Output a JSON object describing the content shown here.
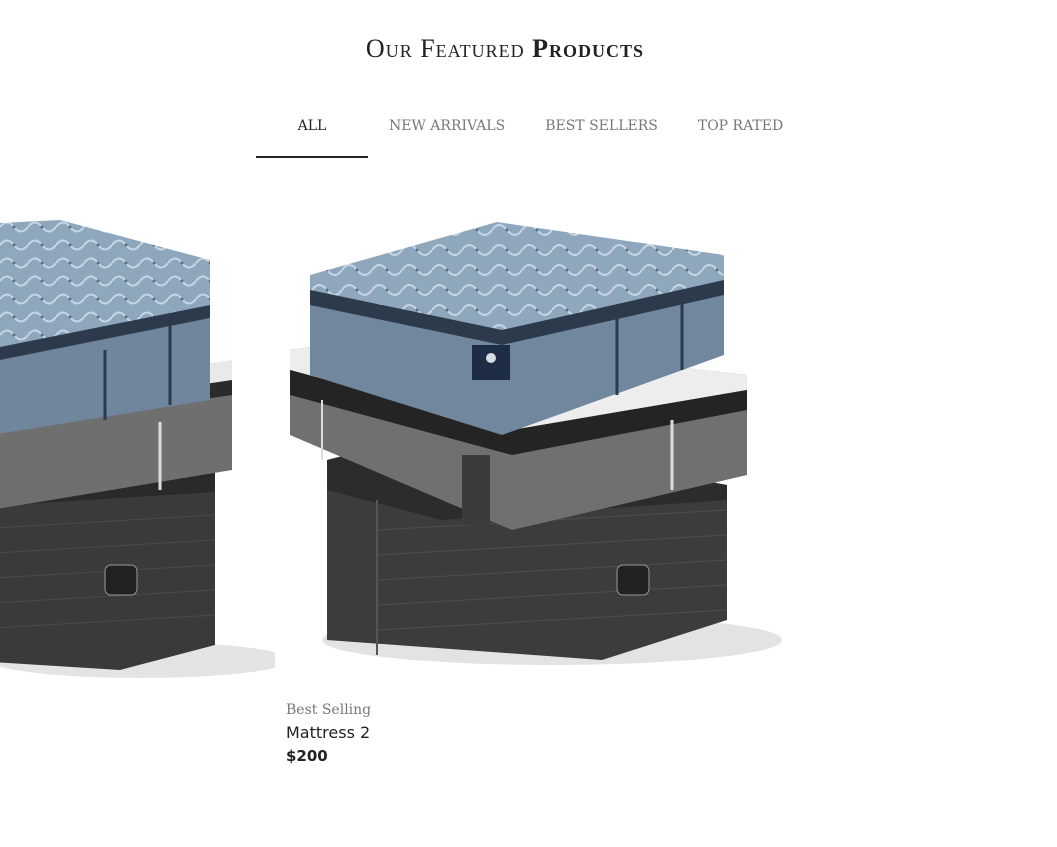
{
  "section": {
    "title_light": "Our Featured",
    "title_bold": "Products"
  },
  "tabs": [
    {
      "label": "ALL",
      "active": true
    },
    {
      "label": "NEW ARRIVALS",
      "active": false
    },
    {
      "label": "BEST SELLERS",
      "active": false
    },
    {
      "label": "TOP RATED",
      "active": false
    }
  ],
  "products": [
    {
      "image_icon": "mattress-stack-image",
      "tag": "",
      "name": "",
      "price": ""
    },
    {
      "image_icon": "mattress-stack-image",
      "tag": "Best Selling",
      "name": "Mattress 2",
      "price": "$200"
    }
  ],
  "colors": {
    "text_dark": "#222222",
    "text_muted": "#777777",
    "mattress_blue": "#7f95ab",
    "mattress_gray": "#6f6f6f",
    "mattress_black": "#3a3a3a"
  }
}
